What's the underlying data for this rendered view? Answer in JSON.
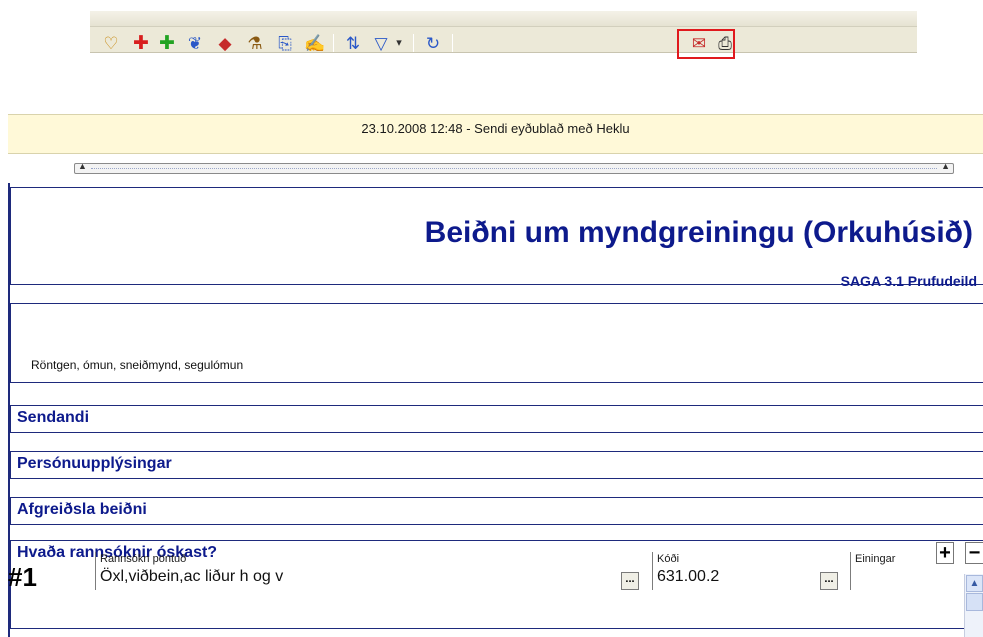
{
  "toolbar": {
    "buttons": [
      {
        "icon": "patient-info-icon",
        "glyph": "♡"
      },
      {
        "icon": "red-cross-icon",
        "glyph": "✚"
      },
      {
        "icon": "green-plus-icon",
        "glyph": "✚"
      },
      {
        "icon": "group-icon",
        "glyph": "❦"
      },
      {
        "icon": "eraser-icon",
        "glyph": "◆"
      },
      {
        "icon": "lab-flask-icon",
        "glyph": "⚗"
      },
      {
        "icon": "document-copy-icon",
        "glyph": "⎘"
      },
      {
        "icon": "sign-document-icon",
        "glyph": "✍"
      },
      {
        "icon": "sort-list-icon",
        "glyph": "⇅"
      },
      {
        "icon": "filter-icon",
        "glyph": "▽"
      },
      {
        "icon": "filter-dropdown-icon",
        "glyph": "▾"
      },
      {
        "icon": "refresh-icon",
        "glyph": "↻"
      },
      {
        "icon": "send-form-icon",
        "glyph": "✉"
      },
      {
        "icon": "print-icon",
        "glyph": "⎙"
      }
    ],
    "colors": {
      "highlight": "#e0191d",
      "red_icon": "#d81e1e",
      "green_icon": "#22a322",
      "blue_icon": "#2a58c8"
    }
  },
  "status": {
    "text": "23.10.2008 12:48 - Sendi eyðublað með Heklu"
  },
  "form": {
    "title": "Beiðni um myndgreiningu (Orkuhúsið)",
    "subtitle": "SAGA 3.1 Prufudeild",
    "description": "Röntgen, ómun, sneiðmynd, segulómun",
    "sections": [
      "Sendandi",
      "Persónuupplýsingar",
      "Afgreiðsla beiðni",
      "Hvaða rannsóknir óskast?"
    ],
    "add_label": "+",
    "remove_label": "−",
    "row": {
      "number": "#1",
      "requested_label": "Rannsókn pöntuð",
      "requested_value": "Öxl,viðbein,ac liður h og v",
      "code_label": "Kóði",
      "code_value": "631.00.2",
      "units_label": "Einingar",
      "lookup_label": "..."
    },
    "colors": {
      "heading": "#0d1a8c",
      "border": "#1e2a7c",
      "status_bg": "#fff9d8"
    }
  }
}
